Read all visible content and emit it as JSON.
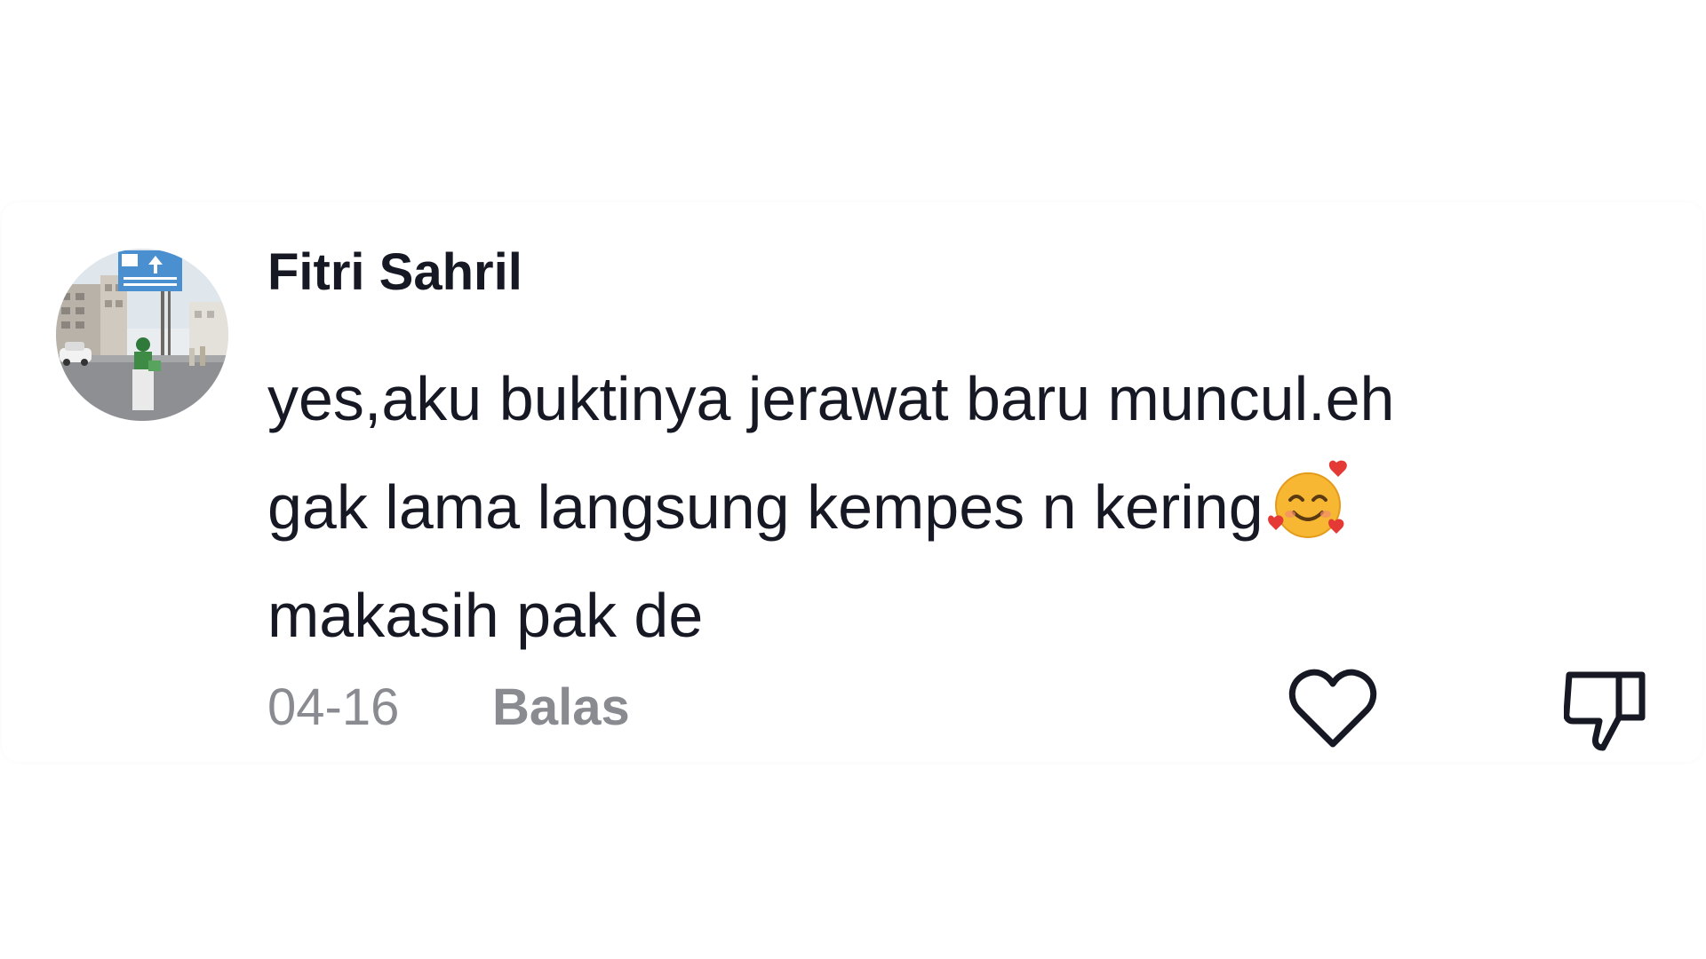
{
  "comment": {
    "username": "Fitri Sahril",
    "text_lines": [
      "yes,aku buktinya jerawat baru muncul.eh",
      "gak lama langsung kempes n kering",
      "makasih pak de"
    ],
    "emoji": "smiling-face-with-hearts",
    "date": "04-16",
    "reply_label": "Balas"
  },
  "icons": {
    "like": "heart-outline-icon",
    "dislike": "thumbs-down-outline-icon"
  },
  "colors": {
    "text_primary": "#161823",
    "text_secondary": "#8a8b91",
    "icon_stroke": "#161823"
  }
}
